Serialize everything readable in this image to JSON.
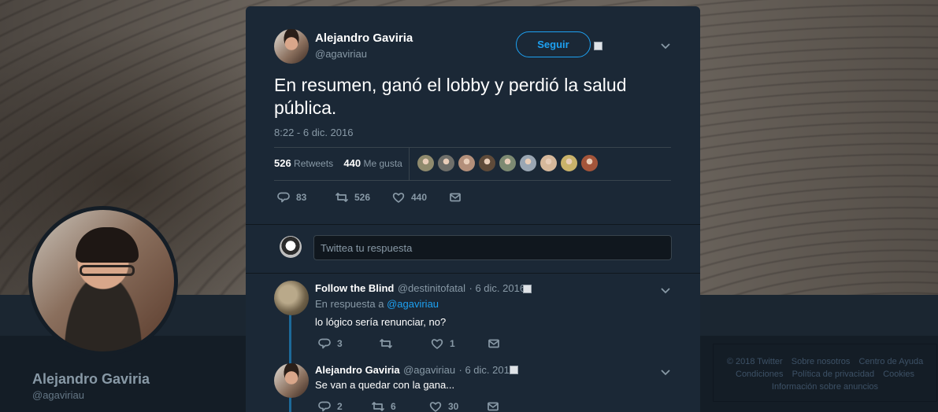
{
  "profile": {
    "name": "Alejandro Gaviria",
    "handle": "@agaviriau"
  },
  "footer": {
    "items_row1": [
      "© 2018 Twitter",
      "Sobre nosotros",
      "Centro de Ayuda"
    ],
    "items_row2": [
      "Condiciones",
      "Política de privacidad",
      "Cookies"
    ],
    "items_row3": [
      "Información sobre anuncios"
    ]
  },
  "tweet": {
    "author_name": "Alejandro Gaviria",
    "author_handle": "@agaviriau",
    "follow_label": "Seguir",
    "text": "En resumen, ganó el lobby y perdió la salud pública.",
    "timestamp": "8:22 - 6 dic. 2016",
    "retweets_count": "526",
    "retweets_label": "Retweets",
    "likes_count": "440",
    "likes_label": "Me gusta",
    "actions": {
      "reply_count": "83",
      "retweet_count": "526",
      "like_count": "440"
    },
    "liker_colors": [
      "#8f8a6d",
      "#6f6f6a",
      "#b38f7a",
      "#5f4b3a",
      "#7d8a72",
      "#9aa6b3",
      "#d6b89b",
      "#c9b26a",
      "#a4553a"
    ]
  },
  "reply_box": {
    "placeholder": "Twittea tu respuesta"
  },
  "replies": [
    {
      "name": "Follow the Blind",
      "handle": "@destinitofatal",
      "date": "· 6 dic. 2016",
      "reply_to_prefix": "En respuesta a",
      "reply_to_handle": "@agaviriau",
      "text": "lo lógico sería renunciar, no?",
      "reply_count": "3",
      "retweet_count": "",
      "like_count": "1"
    },
    {
      "name": "Alejandro Gaviria",
      "handle": "@agaviriau",
      "date": "· 6 dic. 2016",
      "text": "Se van a quedar con la gana...",
      "reply_count": "2",
      "retweet_count": "6",
      "like_count": "30"
    }
  ],
  "colors": {
    "accent": "#1da1f2",
    "modal_bg": "#1b2836",
    "page_bg": "#141d26",
    "muted_text": "#8899a6"
  }
}
